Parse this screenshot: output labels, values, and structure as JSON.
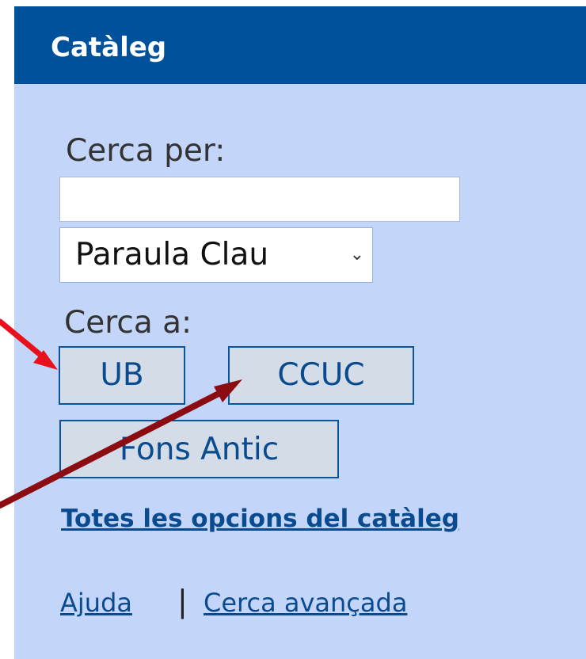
{
  "header": {
    "title": "Catàleg"
  },
  "search": {
    "label": "Cerca per:",
    "input_value": "",
    "select_value": "Paraula Clau",
    "scope_label": "Cerca a:"
  },
  "buttons": {
    "ub": "UB",
    "ccuc": "CCUC",
    "fons_antic": "Fons Antic"
  },
  "links": {
    "all_options": "Totes les opcions del catàleg",
    "help": "Ajuda",
    "separator": "|",
    "advanced": "Cerca avançada"
  },
  "colors": {
    "header_bg": "#00519b",
    "panel_bg": "#c3d6fa",
    "arrow_red": "#e8101a",
    "arrow_dark_red": "#8b0d12"
  },
  "icons": {
    "select_caret": "caret-down-icon",
    "annotation_arrows": "arrow-icon"
  }
}
